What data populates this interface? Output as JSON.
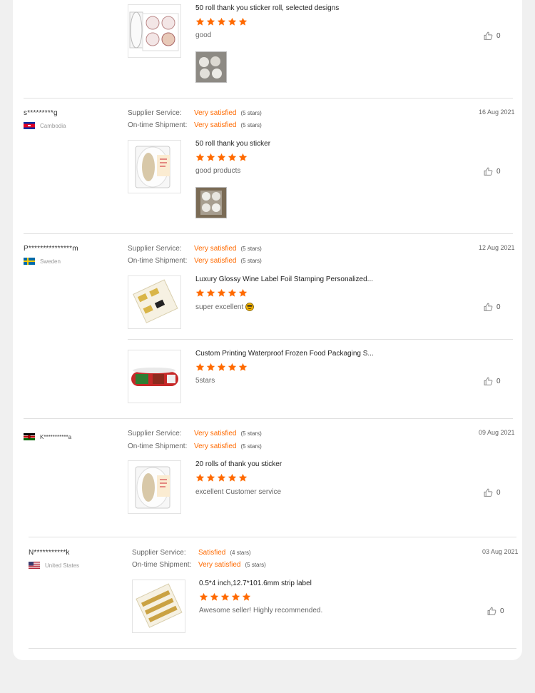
{
  "labels": {
    "supplier_service": "Supplier Service:",
    "ontime_shipment": "On-time Shipment:"
  },
  "colors": {
    "accent": "#ff6a00",
    "star": "#ff6a00"
  },
  "reviews": [
    {
      "products": [
        {
          "title": "50 roll thank you sticker roll, selected designs",
          "rating": 5,
          "comment": "good",
          "likes": "0",
          "has_photo": true
        }
      ]
    },
    {
      "reviewer": "s*********g",
      "country": "Cambodia",
      "date": "16 Aug 2021",
      "supplier_value": "Very satisfied",
      "supplier_stars": "(5 stars)",
      "shipment_value": "Very satisfied",
      "shipment_stars": "(5 stars)",
      "products": [
        {
          "title": "50 roll thank you sticker",
          "rating": 5,
          "comment": "good products",
          "likes": "0",
          "has_photo": true
        }
      ]
    },
    {
      "reviewer": "P***************m",
      "country": "Sweden",
      "date": "12 Aug 2021",
      "supplier_value": "Very satisfied",
      "supplier_stars": "(5 stars)",
      "shipment_value": "Very satisfied",
      "shipment_stars": "(5 stars)",
      "products": [
        {
          "title": "Luxury Glossy Wine Label Foil Stamping Personalized...",
          "rating": 5,
          "comment": "super excellent",
          "emoji": "smiley-emoji",
          "likes": "0"
        },
        {
          "title": "Custom Printing Waterproof Frozen Food Packaging S...",
          "rating": 5,
          "comment": "5stars",
          "likes": "0"
        }
      ]
    },
    {
      "reviewer": "K***********a",
      "date": "09 Aug 2021",
      "supplier_value": "Very satisfied",
      "supplier_stars": "(5 stars)",
      "shipment_value": "Very satisfied",
      "shipment_stars": "(5 stars)",
      "products": [
        {
          "title": "20 rolls of thank you sticker",
          "rating": 5,
          "comment": "excellent Customer service",
          "likes": "0"
        }
      ]
    },
    {
      "reviewer": "N***********k",
      "country": "United States",
      "date": "03 Aug 2021",
      "supplier_value": "Satisfied",
      "supplier_stars": "(4 stars)",
      "shipment_value": "Very satisfied",
      "shipment_stars": "(5 stars)",
      "products": [
        {
          "title": "0.5*4 inch,12.7*101.6mm strip label",
          "rating": 5,
          "comment": "Awesome seller! Highly recommended.",
          "likes": "0"
        }
      ]
    }
  ]
}
